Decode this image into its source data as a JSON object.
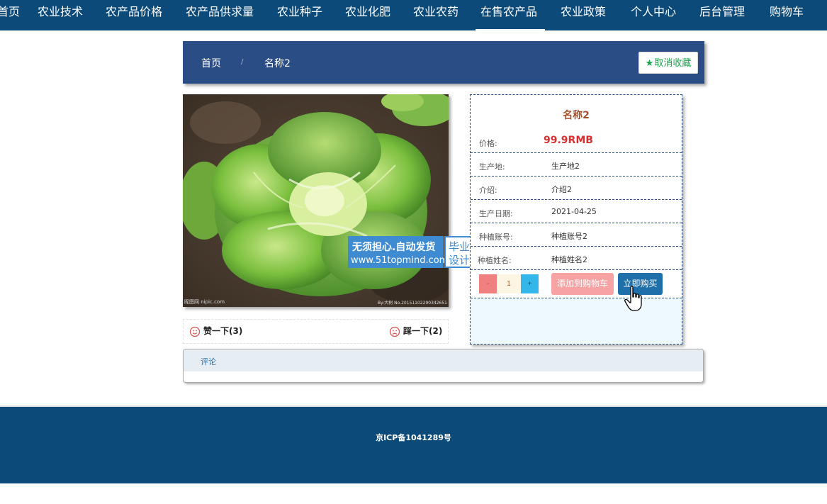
{
  "nav": {
    "items": [
      {
        "label": "首页"
      },
      {
        "label": "农业技术"
      },
      {
        "label": "农产品价格"
      },
      {
        "label": "农产品供求量"
      },
      {
        "label": "农业种子"
      },
      {
        "label": "农业化肥"
      },
      {
        "label": "农业农药"
      },
      {
        "label": "在售农产品"
      },
      {
        "label": "农业政策"
      },
      {
        "label": "个人中心"
      },
      {
        "label": "后台管理"
      },
      {
        "label": "购物车"
      }
    ],
    "active": "在售农产品",
    "bar_color": "#0b4a79"
  },
  "breadcrumb": {
    "home": "首页",
    "separator": "/",
    "current": "名称2",
    "bar_color": "#2a4d85"
  },
  "favorite_button": {
    "icon": "star-icon",
    "label": "取消收藏"
  },
  "image": {
    "credit_left": "昵图网 nipic.com",
    "credit_right": "By:大树 No.20151102290342651"
  },
  "watermark": {
    "line1": "无须担心.自动发货",
    "line2": "www.51topmind.com",
    "side_line1": "毕业",
    "side_line2": "设计"
  },
  "votes": {
    "like": {
      "icon": "smiley-icon",
      "label": "赞一下(3)"
    },
    "dislike": {
      "icon": "frown-icon",
      "label": "踩一下(2)"
    }
  },
  "product": {
    "name": "名称2",
    "price_label": "价格:",
    "price": "99.9RMB",
    "fields": [
      {
        "label": "生产地:",
        "value": "生产地2"
      },
      {
        "label": "介绍:",
        "value": "介绍2"
      },
      {
        "label": "生产日期:",
        "value": "2021-04-25"
      },
      {
        "label": "种植账号:",
        "value": "种植账号2"
      },
      {
        "label": "种植姓名:",
        "value": "种植姓名2"
      }
    ],
    "quantity": "1",
    "minus_label": "-",
    "plus_label": "+",
    "add_to_cart_label": "添加到购物车",
    "buy_now_label": "立即购买"
  },
  "comments": {
    "title": "评论"
  },
  "footer": {
    "icp": "京ICP备1041289号"
  }
}
